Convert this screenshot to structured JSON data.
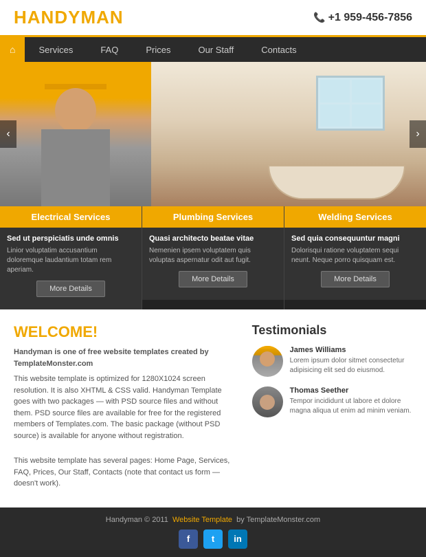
{
  "header": {
    "logo_black": "HANDY",
    "logo_yellow": "MAN",
    "phone_icon": "☎",
    "phone": "+1 959-456-7856"
  },
  "nav": {
    "home_icon": "⌂",
    "items": [
      {
        "label": "Services"
      },
      {
        "label": "FAQ"
      },
      {
        "label": "Prices"
      },
      {
        "label": "Our Staff"
      },
      {
        "label": "Contacts"
      }
    ]
  },
  "services": [
    {
      "title": "Electrical Services",
      "subtitle": "Sed ut perspiciatis unde omnis",
      "body": "Linior voluptatim accusantium doloremque laudantium totam rem aperiam.",
      "btn": "More Details"
    },
    {
      "title": "Plumbing Services",
      "subtitle": "Quasi architecto beatae vitae",
      "body": "Nemenien ipsem voluptatem quis voluptas aspernatur odit aut fugit.",
      "btn": "More Details"
    },
    {
      "title": "Welding Services",
      "subtitle": "Sed quia consequuntur magni",
      "body": "Dolorisqui ratione voluptatem sequi neunt. Neque porro quisquam est.",
      "btn": "More Details"
    }
  ],
  "welcome": {
    "heading": "WELCOME!",
    "intro": "Handyman is one of free website templates created by TemplateMonster.com",
    "p1": "This website template is optimized for 1280X1024 screen resolution. It is also XHTML & CSS valid. Handyman Template goes with two packages — with PSD source files and without them. PSD source files are available for free for the registered members of Templates.com. The basic package (without PSD source) is available for anyone without registration.",
    "p2": "This website template has several pages: Home Page, Services, FAQ, Prices, Our Staff, Contacts (note that contact us form — doesn't work)."
  },
  "testimonials": {
    "heading": "Testimonials",
    "items": [
      {
        "name": "James Williams",
        "text": "Lorem ipsum dolor sitmet consectetur adipisicing elit sed do eiusmod."
      },
      {
        "name": "Thomas Seether",
        "text": "Tempor incididunt ut labore et dolore magna aliqua ut enim ad minim veniam."
      }
    ]
  },
  "footer": {
    "copyright": "Handyman © 2011",
    "link_text": "Website Template",
    "by": "by TemplateMonster.com",
    "social": [
      {
        "name": "facebook",
        "label": "f"
      },
      {
        "name": "twitter",
        "label": "t"
      },
      {
        "name": "linkedin",
        "label": "in"
      }
    ]
  }
}
